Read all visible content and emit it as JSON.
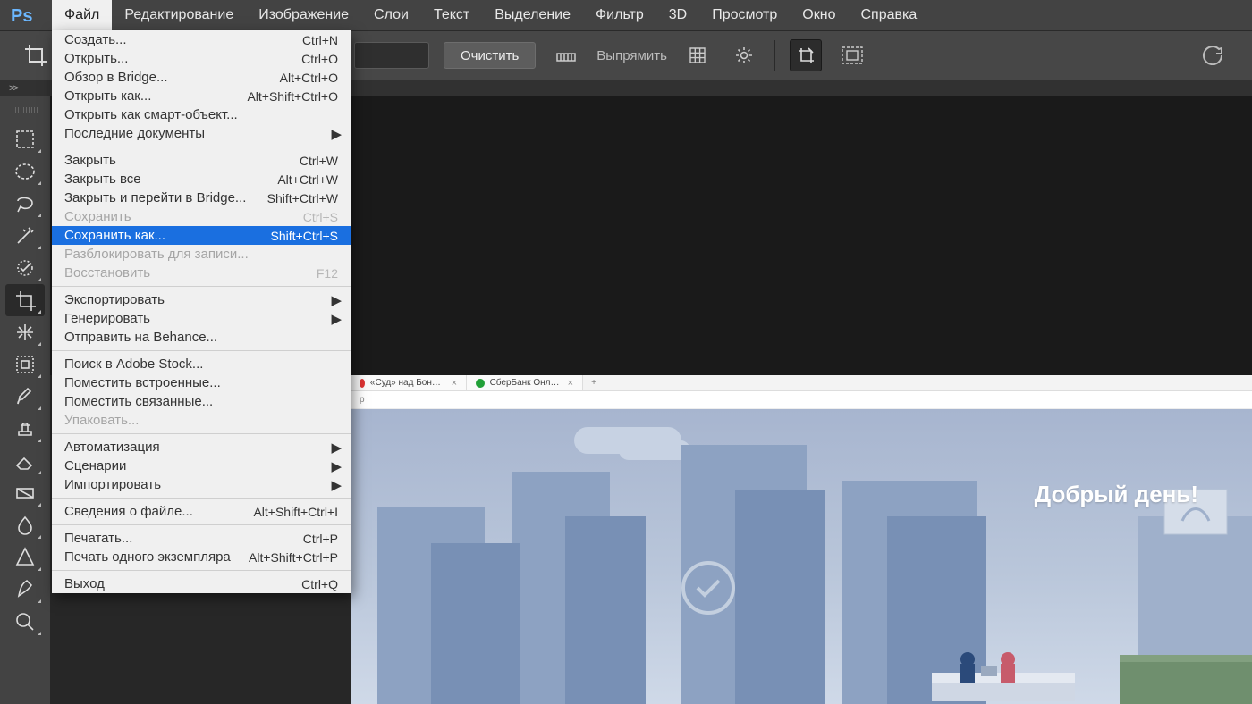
{
  "app": {
    "logo_text": "Ps"
  },
  "menubar": {
    "items": [
      "Файл",
      "Редактирование",
      "Изображение",
      "Слои",
      "Текст",
      "Выделение",
      "Фильтр",
      "3D",
      "Просмотр",
      "Окно",
      "Справка"
    ],
    "active_index": 0
  },
  "optionsbar": {
    "clear_label": "Очистить",
    "straighten_label": "Выпрямить"
  },
  "tabstrip": {
    "arrows": ">>"
  },
  "tools": [
    {
      "name": "marquee",
      "active": false
    },
    {
      "name": "ellipse-marquee",
      "active": false
    },
    {
      "name": "lasso",
      "active": false
    },
    {
      "name": "magic-wand",
      "active": false
    },
    {
      "name": "heal-brush",
      "active": false
    },
    {
      "name": "crop",
      "active": true
    },
    {
      "name": "transform",
      "active": false
    },
    {
      "name": "frame",
      "active": false
    },
    {
      "name": "brush",
      "active": false
    },
    {
      "name": "clone-stamp",
      "active": false
    },
    {
      "name": "eraser",
      "active": false
    },
    {
      "name": "gradient",
      "active": false
    },
    {
      "name": "blur",
      "active": false
    },
    {
      "name": "pen",
      "active": false
    },
    {
      "name": "pen2",
      "active": false
    },
    {
      "name": "zoom",
      "active": false
    }
  ],
  "document": {
    "tabs": [
      {
        "title": "«Суд» над Бондаренко. Кажды",
        "favicon": "#d33"
      },
      {
        "title": "СберБанк Онлайн",
        "favicon": "#21a038"
      }
    ],
    "greeting": "Добрый день!"
  },
  "dropdown": {
    "groups": [
      [
        {
          "label": "Создать...",
          "shortcut": "Ctrl+N"
        },
        {
          "label": "Открыть...",
          "shortcut": "Ctrl+O"
        },
        {
          "label": "Обзор в Bridge...",
          "shortcut": "Alt+Ctrl+O"
        },
        {
          "label": "Открыть как...",
          "shortcut": "Alt+Shift+Ctrl+O"
        },
        {
          "label": "Открыть как смарт-объект..."
        },
        {
          "label": "Последние документы",
          "submenu": true
        }
      ],
      [
        {
          "label": "Закрыть",
          "shortcut": "Ctrl+W"
        },
        {
          "label": "Закрыть все",
          "shortcut": "Alt+Ctrl+W"
        },
        {
          "label": "Закрыть и перейти в Bridge...",
          "shortcut": "Shift+Ctrl+W"
        },
        {
          "label": "Сохранить",
          "shortcut": "Ctrl+S",
          "disabled": true
        },
        {
          "label": "Сохранить как...",
          "shortcut": "Shift+Ctrl+S",
          "highlight": true
        },
        {
          "label": "Разблокировать для записи...",
          "disabled": true
        },
        {
          "label": "Восстановить",
          "shortcut": "F12",
          "disabled": true
        }
      ],
      [
        {
          "label": "Экспортировать",
          "submenu": true
        },
        {
          "label": "Генерировать",
          "submenu": true
        },
        {
          "label": "Отправить на Behance..."
        }
      ],
      [
        {
          "label": "Поиск в Adobe Stock..."
        },
        {
          "label": "Поместить встроенные..."
        },
        {
          "label": "Поместить связанные..."
        },
        {
          "label": "Упаковать...",
          "disabled": true
        }
      ],
      [
        {
          "label": "Автоматизация",
          "submenu": true
        },
        {
          "label": "Сценарии",
          "submenu": true
        },
        {
          "label": "Импортировать",
          "submenu": true
        }
      ],
      [
        {
          "label": "Сведения о файле...",
          "shortcut": "Alt+Shift+Ctrl+I"
        }
      ],
      [
        {
          "label": "Печатать...",
          "shortcut": "Ctrl+P"
        },
        {
          "label": "Печать одного экземпляра",
          "shortcut": "Alt+Shift+Ctrl+P"
        }
      ],
      [
        {
          "label": "Выход",
          "shortcut": "Ctrl+Q"
        }
      ]
    ]
  }
}
